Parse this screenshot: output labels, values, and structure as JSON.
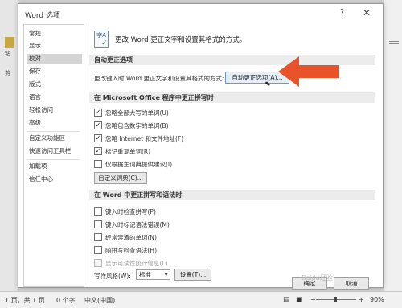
{
  "background": {
    "left_labels": [
      "粘",
      "剪"
    ]
  },
  "statusbar": {
    "page": "1 页，共 1 页",
    "words": "0 个字",
    "language": "中文(中国)",
    "zoom": "90%",
    "zoom_level_percent": 90
  },
  "dialog": {
    "title": "Word 选项",
    "help_label": "?",
    "close_label": "✕",
    "nav": {
      "items": [
        "常规",
        "显示",
        "校对",
        "保存",
        "版式",
        "语言",
        "轻松访问",
        "高级",
        "自定义功能区",
        "快速访问工具栏",
        "加载项",
        "信任中心"
      ],
      "active_index": 2
    },
    "header": {
      "icon_text": "字A",
      "text": "更改 Word 更正文字和设置其格式的方式。"
    },
    "autocorrect": {
      "section_title": "自动更正选项",
      "description": "更改键入时 Word 更正文字和设置其格式的方式:",
      "button_label": "自动更正选项(A)..."
    },
    "office_spelling": {
      "section_title": "在 Microsoft Office 程序中更正拼写时",
      "options": [
        {
          "label": "忽略全部大写的单词(U)",
          "checked": true,
          "disabled": false
        },
        {
          "label": "忽略包含数字的单词(B)",
          "checked": true,
          "disabled": false
        },
        {
          "label": "忽略 Internet 和文件地址(F)",
          "checked": true,
          "disabled": false
        },
        {
          "label": "标记重复单词(R)",
          "checked": true,
          "disabled": false
        },
        {
          "label": "仅根据主词典提供建议(I)",
          "checked": false,
          "disabled": false
        }
      ],
      "custom_dict_button": "自定义词典(C)..."
    },
    "word_spelling": {
      "section_title": "在 Word 中更正拼写和语法时",
      "options": [
        {
          "label": "键入时检查拼写(P)",
          "checked": false,
          "disabled": false
        },
        {
          "label": "键入时标记语法错误(M)",
          "checked": false,
          "disabled": false
        },
        {
          "label": "经常混淆的单词(N)",
          "checked": false,
          "disabled": false
        },
        {
          "label": "随拼写检查语法(H)",
          "checked": false,
          "disabled": false
        },
        {
          "label": "显示可读性统计信息(L)",
          "checked": false,
          "disabled": true
        }
      ],
      "writing_style_label": "写作风格(W):",
      "writing_style_value": "标准",
      "settings_button": "设置(T)..."
    },
    "footer": {
      "ok_button": "确定",
      "cancel_button": "取消"
    }
  },
  "annotation": {
    "arrow_color": "#e8532a"
  },
  "watermark": "Baidu经验"
}
